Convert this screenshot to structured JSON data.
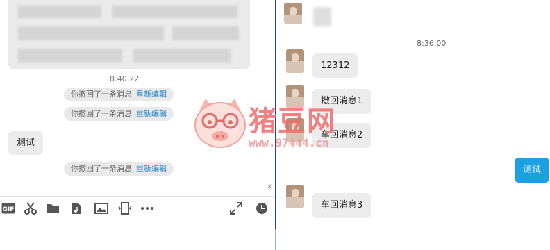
{
  "left_pane": {
    "timestamp": "8:40:22",
    "recall_notice": {
      "text": "你撤回了一条消息",
      "link": "重新编辑"
    },
    "message": "测试",
    "toolbar": {
      "gif_label": "GIF",
      "icons": [
        "gif-icon",
        "scissors-icon",
        "folder-icon",
        "music-file-icon",
        "image-icon",
        "screen-share-icon",
        "more-icon",
        "expand-icon",
        "history-clock-icon"
      ]
    }
  },
  "right_pane": {
    "timestamp": "8:36:00",
    "messages": [
      {
        "text": "12312"
      },
      {
        "text": "撤回消息1"
      },
      {
        "text": "车回消息2"
      },
      {
        "text": "测试"
      },
      {
        "text": "车回消息3"
      }
    ]
  },
  "watermark": {
    "brand": "猪豆网",
    "url": "www.97444.cn"
  },
  "colors": {
    "accent_blue": "#1ba1e2",
    "link_blue": "#2a86c9",
    "divider": "#24497a",
    "watermark_red": "#f26a6a"
  }
}
